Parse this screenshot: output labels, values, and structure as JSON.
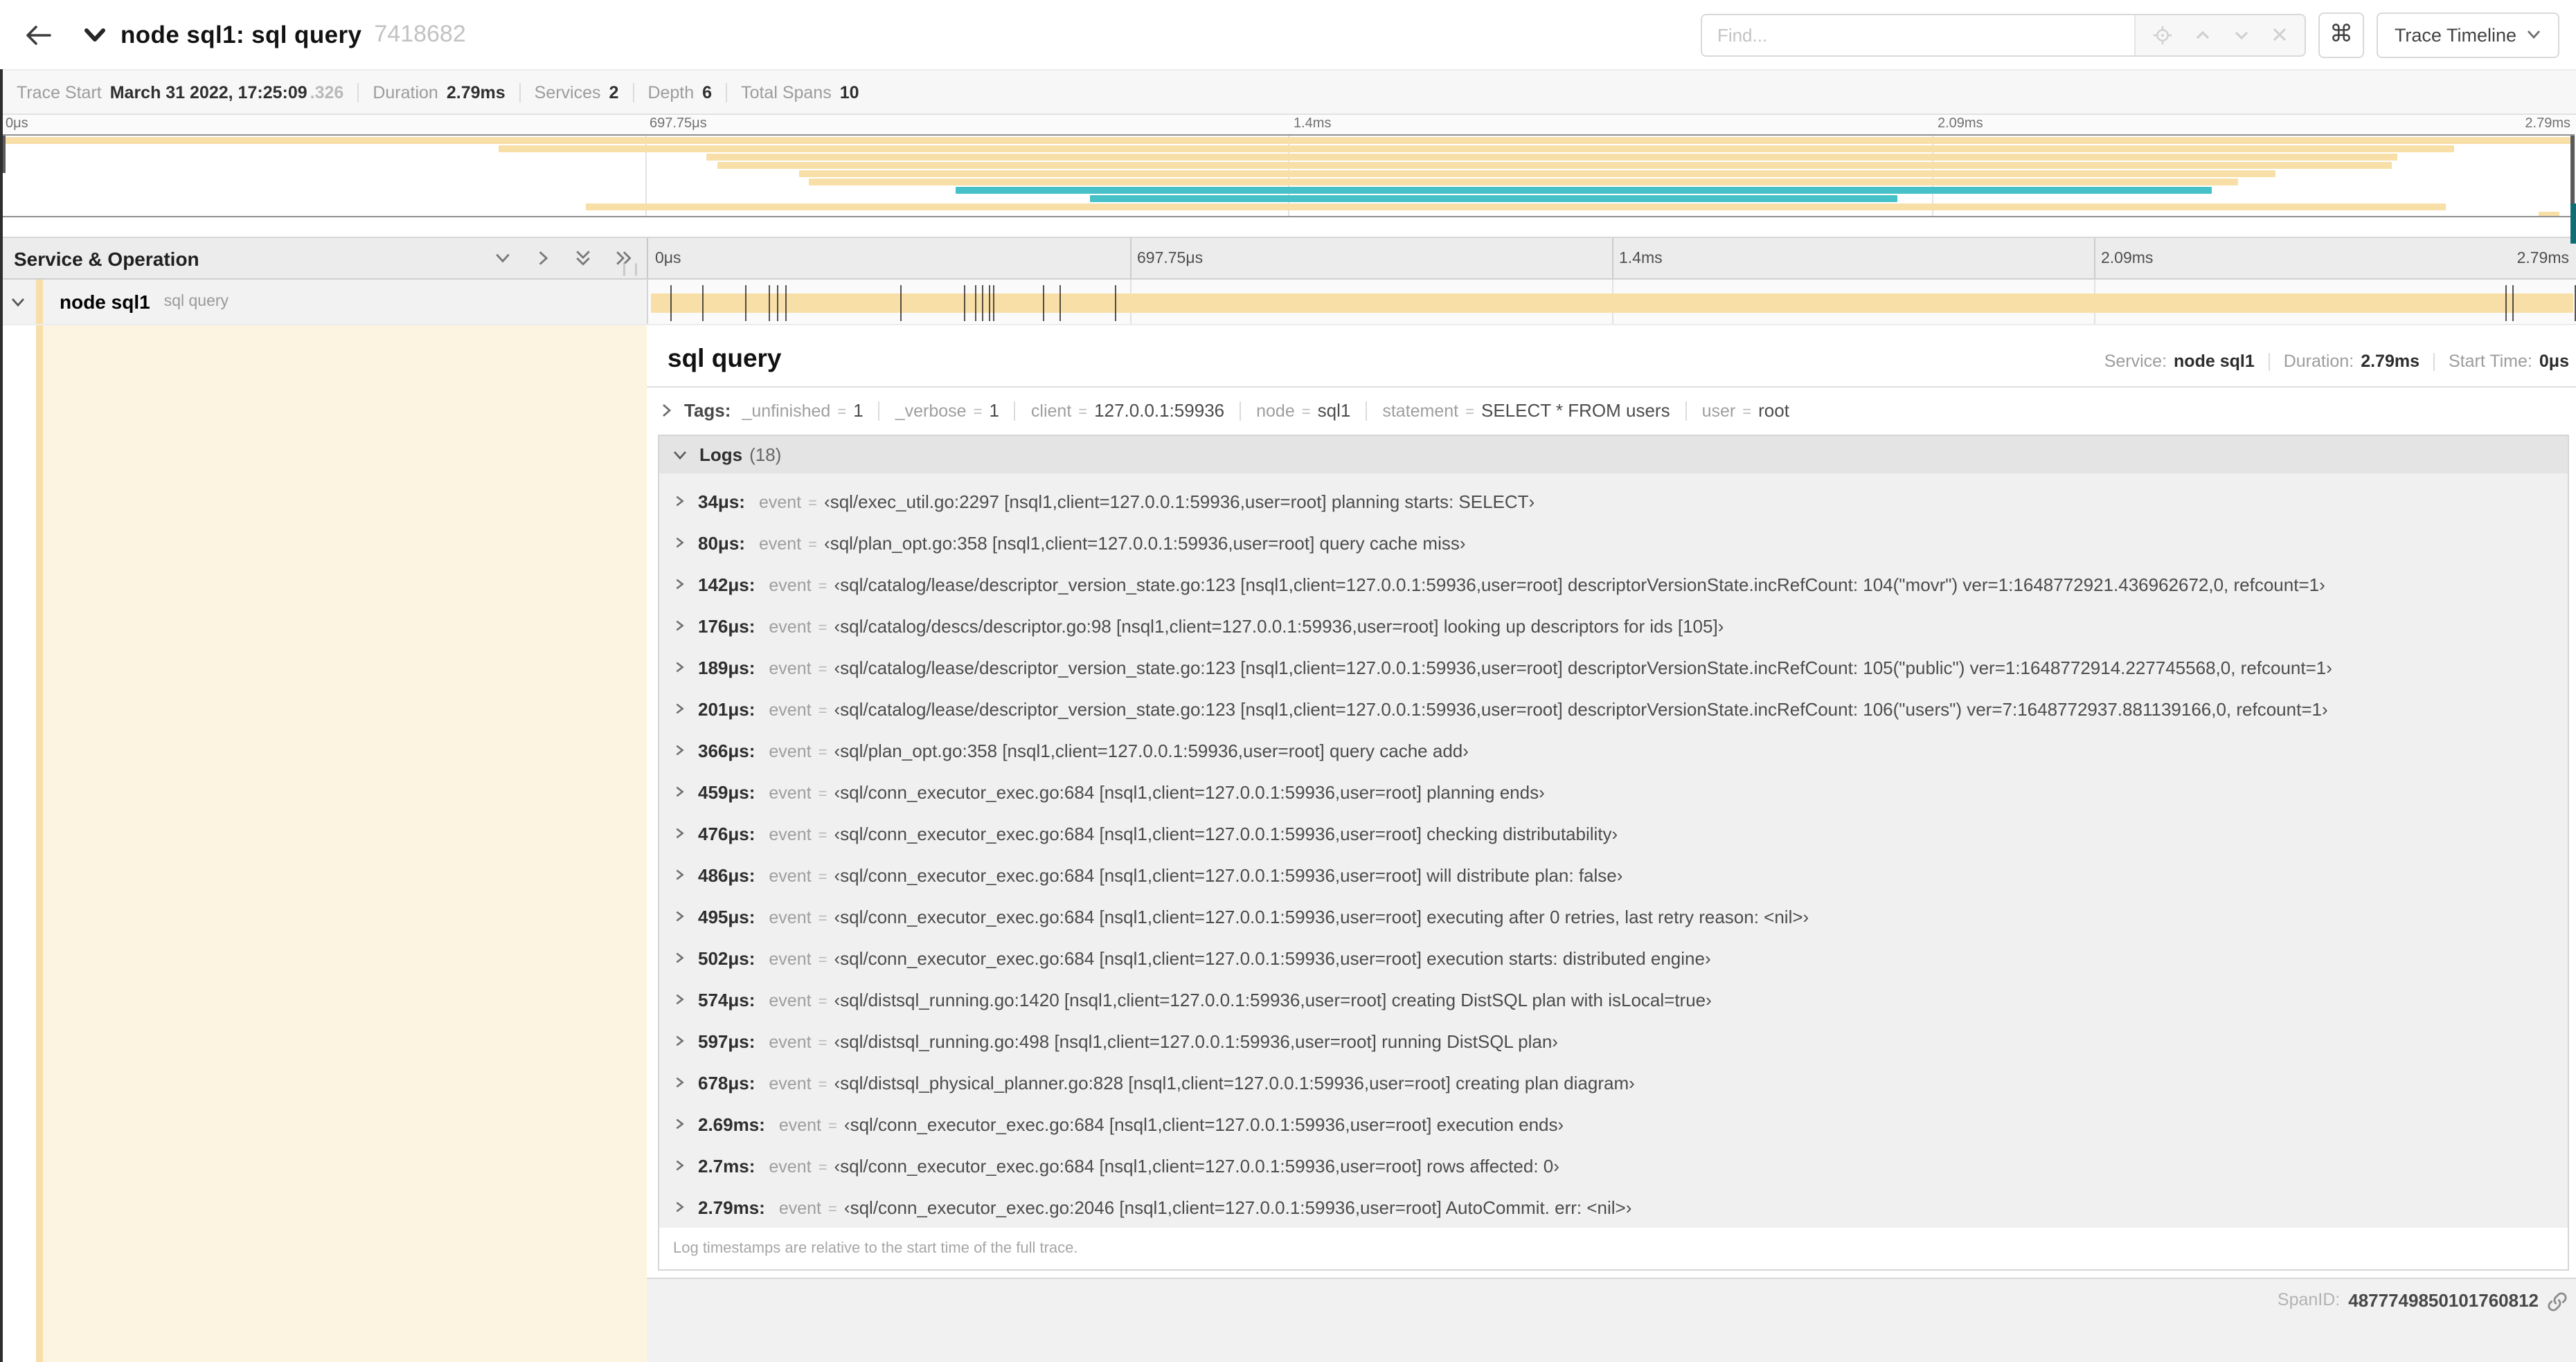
{
  "header": {
    "title": "node sql1: sql query",
    "trace_id": "7418682",
    "find_placeholder": "Find...",
    "shortcut_button": "⌘",
    "view_selector": "Trace Timeline"
  },
  "trace_meta": [
    {
      "label": "Trace Start",
      "value": "March 31 2022, 17:25:09",
      "muted": ".326"
    },
    {
      "label": "Duration",
      "value": "2.79ms"
    },
    {
      "label": "Services",
      "value": "2"
    },
    {
      "label": "Depth",
      "value": "6"
    },
    {
      "label": "Total Spans",
      "value": "10"
    }
  ],
  "timeline": {
    "duration_us": 2790,
    "ruler_labels": [
      "0μs",
      "697.75μs",
      "1.4ms",
      "2.09ms",
      "2.79ms"
    ],
    "ruler_positions": [
      0,
      25,
      50,
      75,
      100
    ],
    "gridline_positions": [
      25,
      50,
      75
    ],
    "colors": {
      "tan": "#F8DFA8",
      "teal": "#46C1C7",
      "cream": "#FCF3E1"
    },
    "minimap_spans": [
      {
        "start": 0,
        "end": 100,
        "color": "tan"
      },
      {
        "start": 19.3,
        "end": 95.3,
        "color": "tan"
      },
      {
        "start": 27.4,
        "end": 93.1,
        "color": "tan"
      },
      {
        "start": 27.8,
        "end": 92.9,
        "color": "tan"
      },
      {
        "start": 31.0,
        "end": 88.4,
        "color": "tan"
      },
      {
        "start": 31.4,
        "end": 86.9,
        "color": "tan"
      },
      {
        "start": 37.1,
        "end": 85.9,
        "color": "teal"
      },
      {
        "start": 42.3,
        "end": 73.7,
        "color": "teal"
      },
      {
        "start": 22.7,
        "end": 95.0,
        "color": "tan"
      },
      {
        "start": 98.6,
        "end": 99.4,
        "color": "tan"
      }
    ]
  },
  "span_list": {
    "header": "Service & Operation",
    "row": {
      "service": "node sql1",
      "operation": "sql query"
    }
  },
  "detail": {
    "title": "sql query",
    "meta": [
      {
        "label": "Service:",
        "value": "node sql1"
      },
      {
        "label": "Duration:",
        "value": "2.79ms"
      },
      {
        "label": "Start Time:",
        "value": "0μs"
      }
    ],
    "tags_label": "Tags:",
    "tags": [
      {
        "key": "_unfinished",
        "value": "1"
      },
      {
        "key": "_verbose",
        "value": "1"
      },
      {
        "key": "client",
        "value": "127.0.0.1:59936"
      },
      {
        "key": "node",
        "value": "sql1"
      },
      {
        "key": "statement",
        "value": "SELECT * FROM users"
      },
      {
        "key": "user",
        "value": "root"
      }
    ],
    "logs_label": "Logs",
    "logs_count": "(18)",
    "logs": [
      {
        "time": "34μs:",
        "t_us": 34,
        "key": "event",
        "value": "‹sql/exec_util.go:2297 [nsql1,client=127.0.0.1:59936,user=root] planning starts: SELECT›"
      },
      {
        "time": "80μs:",
        "t_us": 80,
        "key": "event",
        "value": "‹sql/plan_opt.go:358 [nsql1,client=127.0.0.1:59936,user=root] query cache miss›"
      },
      {
        "time": "142μs:",
        "t_us": 142,
        "key": "event",
        "value": "‹sql/catalog/lease/descriptor_version_state.go:123 [nsql1,client=127.0.0.1:59936,user=root] descriptorVersionState.incRefCount: 104(\"movr\") ver=1:1648772921.436962672,0, refcount=1›"
      },
      {
        "time": "176μs:",
        "t_us": 176,
        "key": "event",
        "value": "‹sql/catalog/descs/descriptor.go:98 [nsql1,client=127.0.0.1:59936,user=root] looking up descriptors for ids [105]›"
      },
      {
        "time": "189μs:",
        "t_us": 189,
        "key": "event",
        "value": "‹sql/catalog/lease/descriptor_version_state.go:123 [nsql1,client=127.0.0.1:59936,user=root] descriptorVersionState.incRefCount: 105(\"public\") ver=1:1648772914.227745568,0, refcount=1›"
      },
      {
        "time": "201μs:",
        "t_us": 201,
        "key": "event",
        "value": "‹sql/catalog/lease/descriptor_version_state.go:123 [nsql1,client=127.0.0.1:59936,user=root] descriptorVersionState.incRefCount: 106(\"users\") ver=7:1648772937.881139166,0, refcount=1›"
      },
      {
        "time": "366μs:",
        "t_us": 366,
        "key": "event",
        "value": "‹sql/plan_opt.go:358 [nsql1,client=127.0.0.1:59936,user=root] query cache add›"
      },
      {
        "time": "459μs:",
        "t_us": 459,
        "key": "event",
        "value": "‹sql/conn_executor_exec.go:684 [nsql1,client=127.0.0.1:59936,user=root] planning ends›"
      },
      {
        "time": "476μs:",
        "t_us": 476,
        "key": "event",
        "value": "‹sql/conn_executor_exec.go:684 [nsql1,client=127.0.0.1:59936,user=root] checking distributability›"
      },
      {
        "time": "486μs:",
        "t_us": 486,
        "key": "event",
        "value": "‹sql/conn_executor_exec.go:684 [nsql1,client=127.0.0.1:59936,user=root] will distribute plan: false›"
      },
      {
        "time": "495μs:",
        "t_us": 495,
        "key": "event",
        "value": "‹sql/conn_executor_exec.go:684 [nsql1,client=127.0.0.1:59936,user=root] executing after 0 retries, last retry reason: <nil>›"
      },
      {
        "time": "502μs:",
        "t_us": 502,
        "key": "event",
        "value": "‹sql/conn_executor_exec.go:684 [nsql1,client=127.0.0.1:59936,user=root] execution starts: distributed engine›"
      },
      {
        "time": "574μs:",
        "t_us": 574,
        "key": "event",
        "value": "‹sql/distsql_running.go:1420 [nsql1,client=127.0.0.1:59936,user=root] creating DistSQL plan with isLocal=true›"
      },
      {
        "time": "597μs:",
        "t_us": 597,
        "key": "event",
        "value": "‹sql/distsql_running.go:498 [nsql1,client=127.0.0.1:59936,user=root] running DistSQL plan›"
      },
      {
        "time": "678μs:",
        "t_us": 678,
        "key": "event",
        "value": "‹sql/distsql_physical_planner.go:828 [nsql1,client=127.0.0.1:59936,user=root] creating plan diagram›"
      },
      {
        "time": "2.69ms:",
        "t_us": 2690,
        "key": "event",
        "value": "‹sql/conn_executor_exec.go:684 [nsql1,client=127.0.0.1:59936,user=root] execution ends›"
      },
      {
        "time": "2.7ms:",
        "t_us": 2700,
        "key": "event",
        "value": "‹sql/conn_executor_exec.go:684 [nsql1,client=127.0.0.1:59936,user=root] rows affected: 0›"
      },
      {
        "time": "2.79ms:",
        "t_us": 2790,
        "key": "event",
        "value": "‹sql/conn_executor_exec.go:2046 [nsql1,client=127.0.0.1:59936,user=root] AutoCommit. err: <nil>›"
      }
    ],
    "logs_footnote": "Log timestamps are relative to the start time of the full trace.",
    "span_id_label": "SpanID:",
    "span_id": "4877749850101760812"
  }
}
